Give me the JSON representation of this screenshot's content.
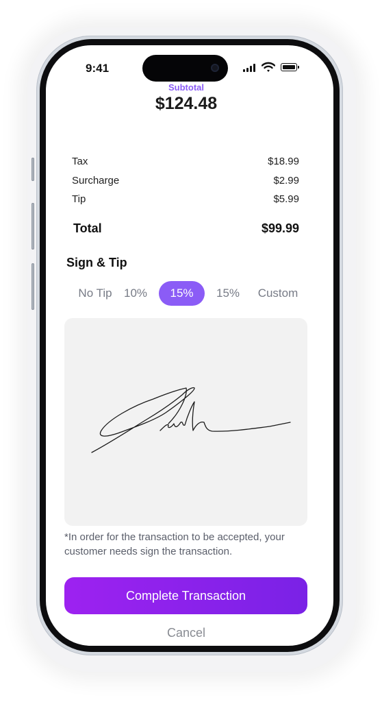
{
  "status_bar": {
    "time": "9:41"
  },
  "summary": {
    "subtotal_label": "Subtotal",
    "subtotal_amount": "$124.48",
    "lines": [
      {
        "label": "Tax",
        "amount": "$18.99"
      },
      {
        "label": "Surcharge",
        "amount": "$2.99"
      },
      {
        "label": "Tip",
        "amount": "$5.99"
      }
    ],
    "total_label": "Total",
    "total_amount": "$99.99"
  },
  "sign_tip": {
    "title": "Sign & Tip",
    "options": [
      {
        "label": "No Tip",
        "selected": false
      },
      {
        "label": "10%",
        "selected": false
      },
      {
        "label": "15%",
        "selected": true
      },
      {
        "label": "15%",
        "selected": false
      },
      {
        "label": "Custom",
        "selected": false
      }
    ],
    "note": "*In order for the transaction to be accepted, your customer needs sign the transaction."
  },
  "actions": {
    "complete_label": "Complete Transaction",
    "cancel_label": "Cancel"
  },
  "colors": {
    "accent": "#8b5cf6",
    "button_gradient_start": "#9d22f0",
    "button_gradient_end": "#7a22e6",
    "signature_pad_bg": "#f2f2f2"
  }
}
